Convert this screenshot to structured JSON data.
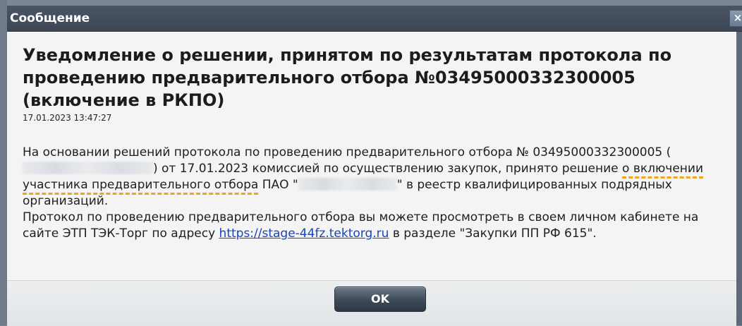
{
  "dialog": {
    "title": "Сообщение",
    "close_icon": "close-icon",
    "heading": "Уведомление о решении, принятом по результатам протокола по проведению предварительного отбора №03495000332300005 (включение в РКПО)",
    "timestamp": "17.01.2023 13:47:27",
    "body": {
      "p1_part1": "На основании решений протокола по проведению предварительного отбора № 03495000332300005 (",
      "p1_part2": ") от 17.01.2023 комиссией по осуществлению закупок, принято решение ",
      "p1_highlight": "о включении участника предварительного отбора",
      "p1_part3": " ПАО \"",
      "p1_part4": "\" в реестр квалифицированных подрядных организаций.",
      "p2_part1": "Протокол по проведению предварительного отбора вы можете просмотреть в своем личном кабинете на сайте ЭТП ТЭК-Торг по адресу ",
      "p2_link": "https://stage-44fz.tektorg.ru",
      "p2_part2": " в разделе \"Закупки ПП РФ 615\"."
    },
    "ok_label": "OK"
  },
  "colors": {
    "titlebar": "#3c4654",
    "highlight_underline": "#f0a321",
    "link": "#1a44b8"
  }
}
